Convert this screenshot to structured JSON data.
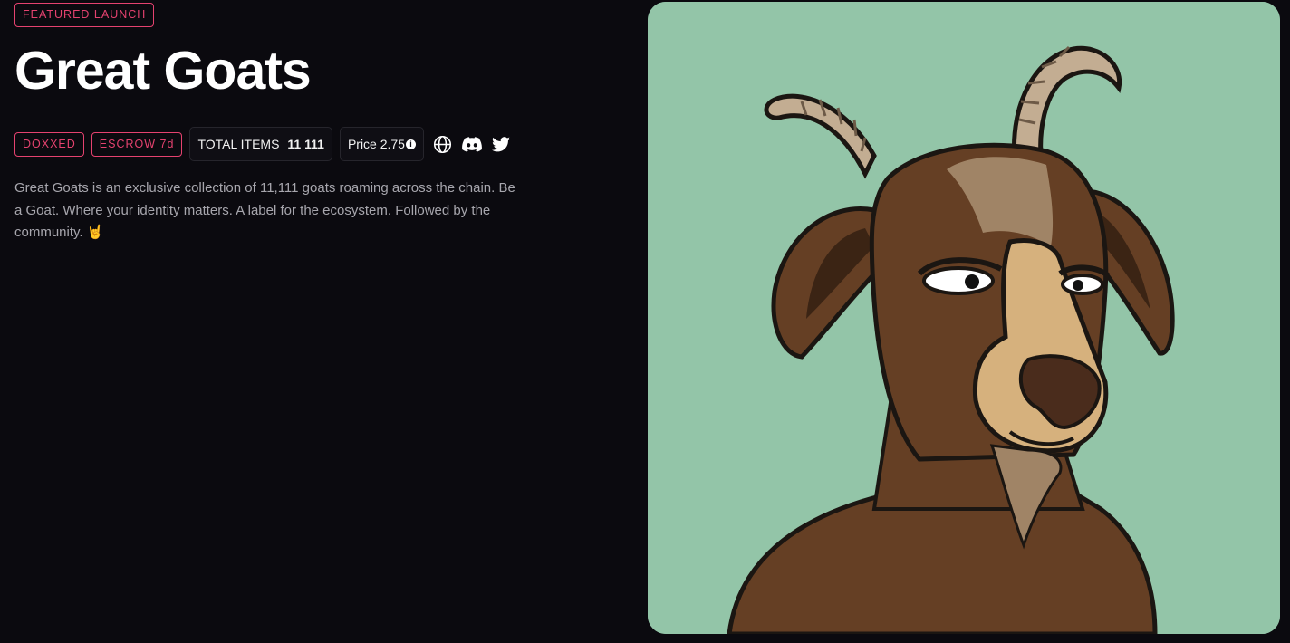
{
  "featured_label": "FEATURED LAUNCH",
  "collection": {
    "title": "Great Goats",
    "tags": [
      "DOXXED",
      "ESCROW 7d"
    ],
    "total_items_label": "TOTAL ITEMS",
    "total_items_value": "11 111",
    "price_label": "Price 2.75",
    "description": "Great Goats is an exclusive collection of 11,111 goats roaming across the chain. Be a Goat. Where your identity matters. A label for the ecosystem. Followed by the community. 🤘"
  },
  "social_icons": [
    "globe-icon",
    "discord-icon",
    "twitter-icon"
  ],
  "colors": {
    "background": "#0b0a0f",
    "accent": "#e5426f",
    "art_background": "#93c5a8",
    "fur": "#653f24",
    "muzzle": "#d6b17d",
    "horn": "#c3ad92"
  }
}
